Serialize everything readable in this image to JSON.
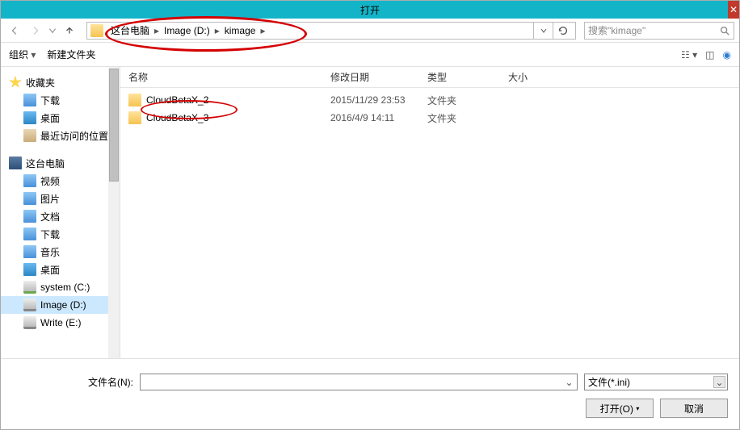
{
  "window": {
    "title": "打开"
  },
  "nav": {
    "breadcrumb": [
      "这台电脑",
      "Image (D:)",
      "kimage"
    ],
    "search_placeholder": "搜索\"kimage\""
  },
  "toolbar": {
    "organize": "组织",
    "newfolder": "新建文件夹"
  },
  "sidebar": {
    "favorites": "收藏夹",
    "fav_items": [
      "下载",
      "桌面",
      "最近访问的位置"
    ],
    "thispc": "这台电脑",
    "pc_items": [
      "视频",
      "图片",
      "文档",
      "下载",
      "音乐",
      "桌面",
      "system (C:)",
      "Image (D:)",
      "Write (E:)"
    ]
  },
  "columns": {
    "name": "名称",
    "date": "修改日期",
    "type": "类型",
    "size": "大小"
  },
  "files": [
    {
      "name": "CloudBetaX_2",
      "date": "2015/11/29 23:53",
      "type": "文件夹"
    },
    {
      "name": "CloudBetaX_3",
      "date": "2016/4/9 14:11",
      "type": "文件夹"
    }
  ],
  "bottom": {
    "filename_label": "文件名(N):",
    "filter": "文件(*.ini)",
    "open": "打开(O)",
    "cancel": "取消"
  }
}
